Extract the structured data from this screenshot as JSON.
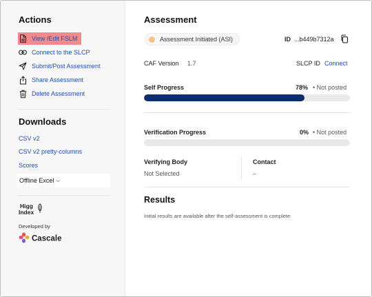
{
  "sidebar": {
    "actions_title": "Actions",
    "actions": [
      {
        "label": "View /Edit FSLM",
        "icon": "document-icon",
        "highlighted": true
      },
      {
        "label": "Connect to the SLCP",
        "icon": "link-icon"
      },
      {
        "label": "Submit/Post Assessment",
        "icon": "send-icon"
      },
      {
        "label": "Share Assessment",
        "icon": "share-icon"
      },
      {
        "label": "Delete Assessment",
        "icon": "trash-icon"
      }
    ],
    "downloads_title": "Downloads",
    "downloads": [
      {
        "label": "CSV v2"
      },
      {
        "label": "CSV v2 pretty-columns"
      },
      {
        "label": "Scores"
      }
    ],
    "offline_excel": "Offline Excel",
    "higg_logo_text": "Higg Index",
    "developed_by": "Developed by",
    "cascale_text": "Cascale"
  },
  "main": {
    "title": "Assessment",
    "status": "Assessment Initiated (ASI)",
    "id_label": "ID",
    "id_value": "...b449b7312a",
    "caf_label": "CAF Version",
    "caf_value": "1.7",
    "slcp_label": "SLCP ID",
    "slcp_link": "Connect",
    "self_progress_label": "Self Progress",
    "self_progress_percent": "78%",
    "self_progress_fraction": 0.78,
    "self_progress_status": "• Not posted",
    "verification_label": "Verification Progress",
    "verification_percent": "0%",
    "verification_fraction": 0,
    "verification_status": "• Not posted",
    "verifying_body_label": "Verifying Body",
    "verifying_body_value": "Not Selected",
    "contact_label": "Contact",
    "contact_value": "–",
    "results_title": "Results",
    "results_note": "Initial results are available after the self-assessment is complete"
  },
  "colors": {
    "link": "#1f4fa8",
    "highlight": "#f08a8d",
    "progress_fill": "#0a2d6e",
    "status_dot": "#f6c087"
  }
}
